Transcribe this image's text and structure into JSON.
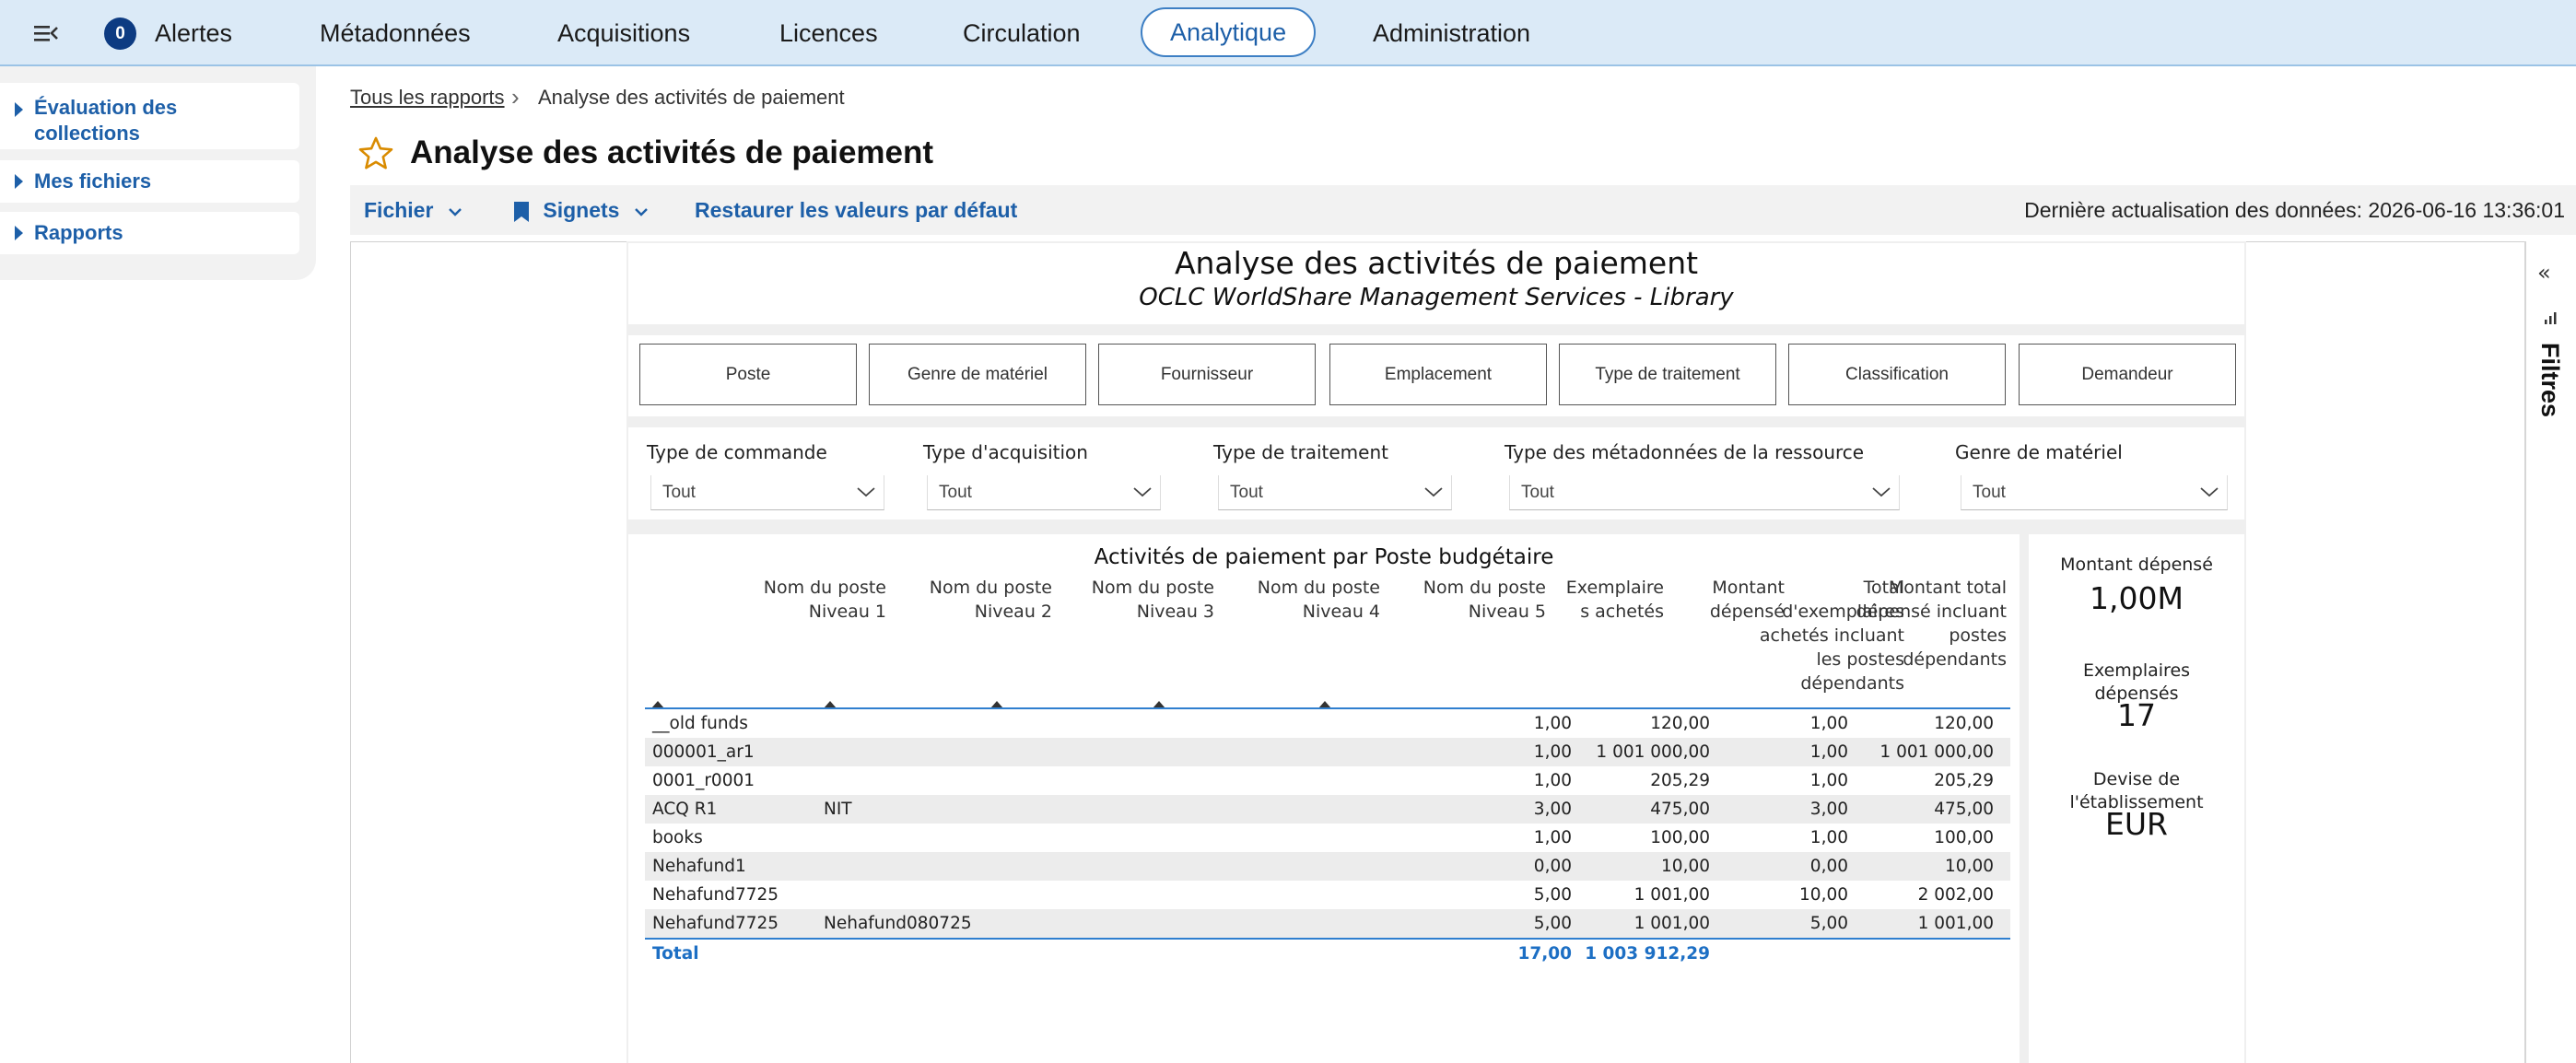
{
  "topnav": {
    "alert_count": "0",
    "items": [
      "Alertes",
      "Métadonnées",
      "Acquisitions",
      "Licences",
      "Circulation",
      "Analytique",
      "Administration"
    ],
    "active": "Analytique"
  },
  "sidebar": {
    "items": [
      {
        "label_line1": "Évaluation des",
        "label_line2": "collections"
      },
      {
        "label": "Mes fichiers"
      },
      {
        "label": "Rapports"
      }
    ]
  },
  "breadcrumb": {
    "link": "Tous les rapports",
    "separator": "›",
    "current": "Analyse des activités de paiement"
  },
  "page": {
    "title": "Analyse des activités de paiement"
  },
  "toolbar": {
    "file_label": "Fichier",
    "bookmarks_label": "Signets",
    "reset_label": "Restaurer les valeurs par défaut",
    "last_update": "Dernière actualisation des données: 2026-06-16 13:36:01"
  },
  "report": {
    "title": "Analyse des activités de paiement",
    "subtitle": "OCLC WorldShare Management Services - Library",
    "buttons": [
      "Poste",
      "Genre de matériel",
      "Fournisseur",
      "Emplacement",
      "Type de traitement",
      "Classification",
      "Demandeur"
    ],
    "slicers": [
      {
        "label": "Type de commande",
        "value": "Tout"
      },
      {
        "label": "Type d'acquisition",
        "value": "Tout"
      },
      {
        "label": "Type de traitement",
        "value": "Tout"
      },
      {
        "label": "Type des métadonnées de la ressource",
        "value": "Tout"
      },
      {
        "label": "Genre de matériel",
        "value": "Tout"
      }
    ],
    "table": {
      "title": "Activités de paiement par Poste budgétaire",
      "headers": [
        [
          "Nom du poste",
          "Niveau 1"
        ],
        [
          "Nom du poste",
          "Niveau 2"
        ],
        [
          "Nom du poste",
          "Niveau 3"
        ],
        [
          "Nom du poste",
          "Niveau 4"
        ],
        [
          "Nom du poste",
          "Niveau 5"
        ],
        [
          "Exemplaire",
          "s achetés"
        ],
        [
          "Montant",
          "dépensé"
        ],
        [
          "Total",
          "d'exemplaires",
          "achetés incluant",
          "les postes",
          "dépendants"
        ],
        [
          "Montant total",
          "dépensé incluant",
          "postes",
          "dépendants"
        ]
      ],
      "rows": [
        {
          "n1": "__old funds",
          "n2": "",
          "qty": "1,00",
          "amt": "120,00",
          "tot_qty": "1,00",
          "tot_amt": "120,00"
        },
        {
          "n1": "000001_ar1",
          "n2": "",
          "qty": "1,00",
          "amt": "1 001 000,00",
          "tot_qty": "1,00",
          "tot_amt": "1 001 000,00"
        },
        {
          "n1": "0001_r0001",
          "n2": "",
          "qty": "1,00",
          "amt": "205,29",
          "tot_qty": "1,00",
          "tot_amt": "205,29"
        },
        {
          "n1": "ACQ R1",
          "n2": "NIT",
          "qty": "3,00",
          "amt": "475,00",
          "tot_qty": "3,00",
          "tot_amt": "475,00"
        },
        {
          "n1": "books",
          "n2": "",
          "qty": "1,00",
          "amt": "100,00",
          "tot_qty": "1,00",
          "tot_amt": "100,00"
        },
        {
          "n1": "Nehafund1",
          "n2": "",
          "qty": "0,00",
          "amt": "10,00",
          "tot_qty": "0,00",
          "tot_amt": "10,00"
        },
        {
          "n1": "Nehafund7725",
          "n2": "",
          "qty": "5,00",
          "amt": "1 001,00",
          "tot_qty": "10,00",
          "tot_amt": "2 002,00"
        },
        {
          "n1": "Nehafund7725",
          "n2": "Nehafund080725",
          "qty": "5,00",
          "amt": "1 001,00",
          "tot_qty": "5,00",
          "tot_amt": "1 001,00"
        }
      ],
      "total": {
        "label": "Total",
        "qty": "17,00",
        "amt": "1 003 912,29"
      }
    },
    "kpis": {
      "spent_label": "Montant dépensé",
      "spent_value": "1,00M",
      "copies_label_line1": "Exemplaires",
      "copies_label_line2": "dépensés",
      "copies_value": "17",
      "currency_label_line1": "Devise de",
      "currency_label_line2": "l'établissement",
      "currency_value": "EUR"
    }
  },
  "filters": {
    "collapse_glyph": "«",
    "label": "Filtres"
  },
  "colors": {
    "nav_bg": "#dbeaf7",
    "accent": "#1d5fa8",
    "badge": "#0d3b82",
    "table_line": "#2f7fcf",
    "total_text": "#1d6fc4",
    "star": "#d98b00"
  }
}
